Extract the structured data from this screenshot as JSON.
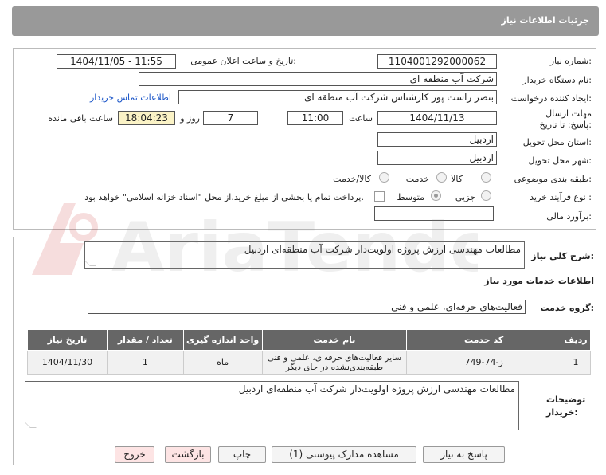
{
  "header": {
    "title": "جزئیات اطلاعات نیاز"
  },
  "fields": {
    "need_number_label": "شماره نیاز:",
    "need_number": "1104001292000062",
    "announce_label": "تاریخ و ساعت اعلان عمومی:",
    "announce_value": "1404/11/05 - 11:55",
    "buyer_org_label": "نام دستگاه خریدار:",
    "buyer_org": "شرکت آب منطقه ای",
    "creator_label": "ایجاد کننده درخواست:",
    "creator": "بنصر راست پور کارشناس شرکت آب منطقه ای",
    "contact_link": "اطلاعات تماس خریدار",
    "deadline_label": "مهلت ارسال پاسخ: تا تاریخ:",
    "deadline_date": "1404/11/13",
    "time_label": "ساعت",
    "deadline_time": "11:00",
    "days_value": "7",
    "days_label": "روز و",
    "remaining_time": "18:04:23",
    "remaining_label": "ساعت باقی مانده",
    "province_label": "استان محل تحویل:",
    "province": "اردبیل",
    "city_label": "شهر محل تحویل:",
    "city": "اردبیل",
    "category_label": "طبقه بندی موضوعی:",
    "category_options": [
      "کالا",
      "خدمت",
      "کالا/خدمت"
    ],
    "process_label": "نوع فرآیند خرید :",
    "process_options": [
      "جزیی",
      "متوسط"
    ],
    "payment_note": "پرداخت تمام یا بخشی از مبلغ خرید،از محل \"اسناد خزانه اسلامی\" خواهد بود.",
    "estimate_label": "برآورد مالی:",
    "estimate": ""
  },
  "description": {
    "label": "شرح کلی نیاز:",
    "value": "مطالعات مهندسی ارزش پروژه اولویت‌دار شرکت آب منطقه‌ای اردبیل"
  },
  "services": {
    "section_title": "اطلاعات خدمات مورد نیاز",
    "group_label": "گروه خدمت:",
    "group_value": "فعالیت‌های حرفه‌ای، علمی و فنی",
    "table_headers": [
      "ردیف",
      "کد خدمت",
      "نام خدمت",
      "واحد اندازه گیری",
      "تعداد / مقدار",
      "تاریخ نیاز"
    ],
    "rows": [
      [
        "1",
        "ز-74-749",
        "سایر فعالیت‌های حرفه‌ای، علمی و فنی طبقه‌بندی‌نشده در جای دیگر",
        "ماه",
        "1",
        "1404/11/30"
      ]
    ]
  },
  "buyer_notes": {
    "label": "توضیحات خریدار:",
    "value": "مطالعات مهندسی ارزش پروژه اولویت‌دار شرکت آب منطقه‌ای اردبیل"
  },
  "buttons": {
    "reply": "پاسخ به نیاز",
    "docs": "مشاهده مدارک پیوستی (1)",
    "print": "چاپ",
    "back": "بازگشت",
    "exit": "خروج"
  },
  "watermark": {
    "text": "AriaTender.net"
  }
}
